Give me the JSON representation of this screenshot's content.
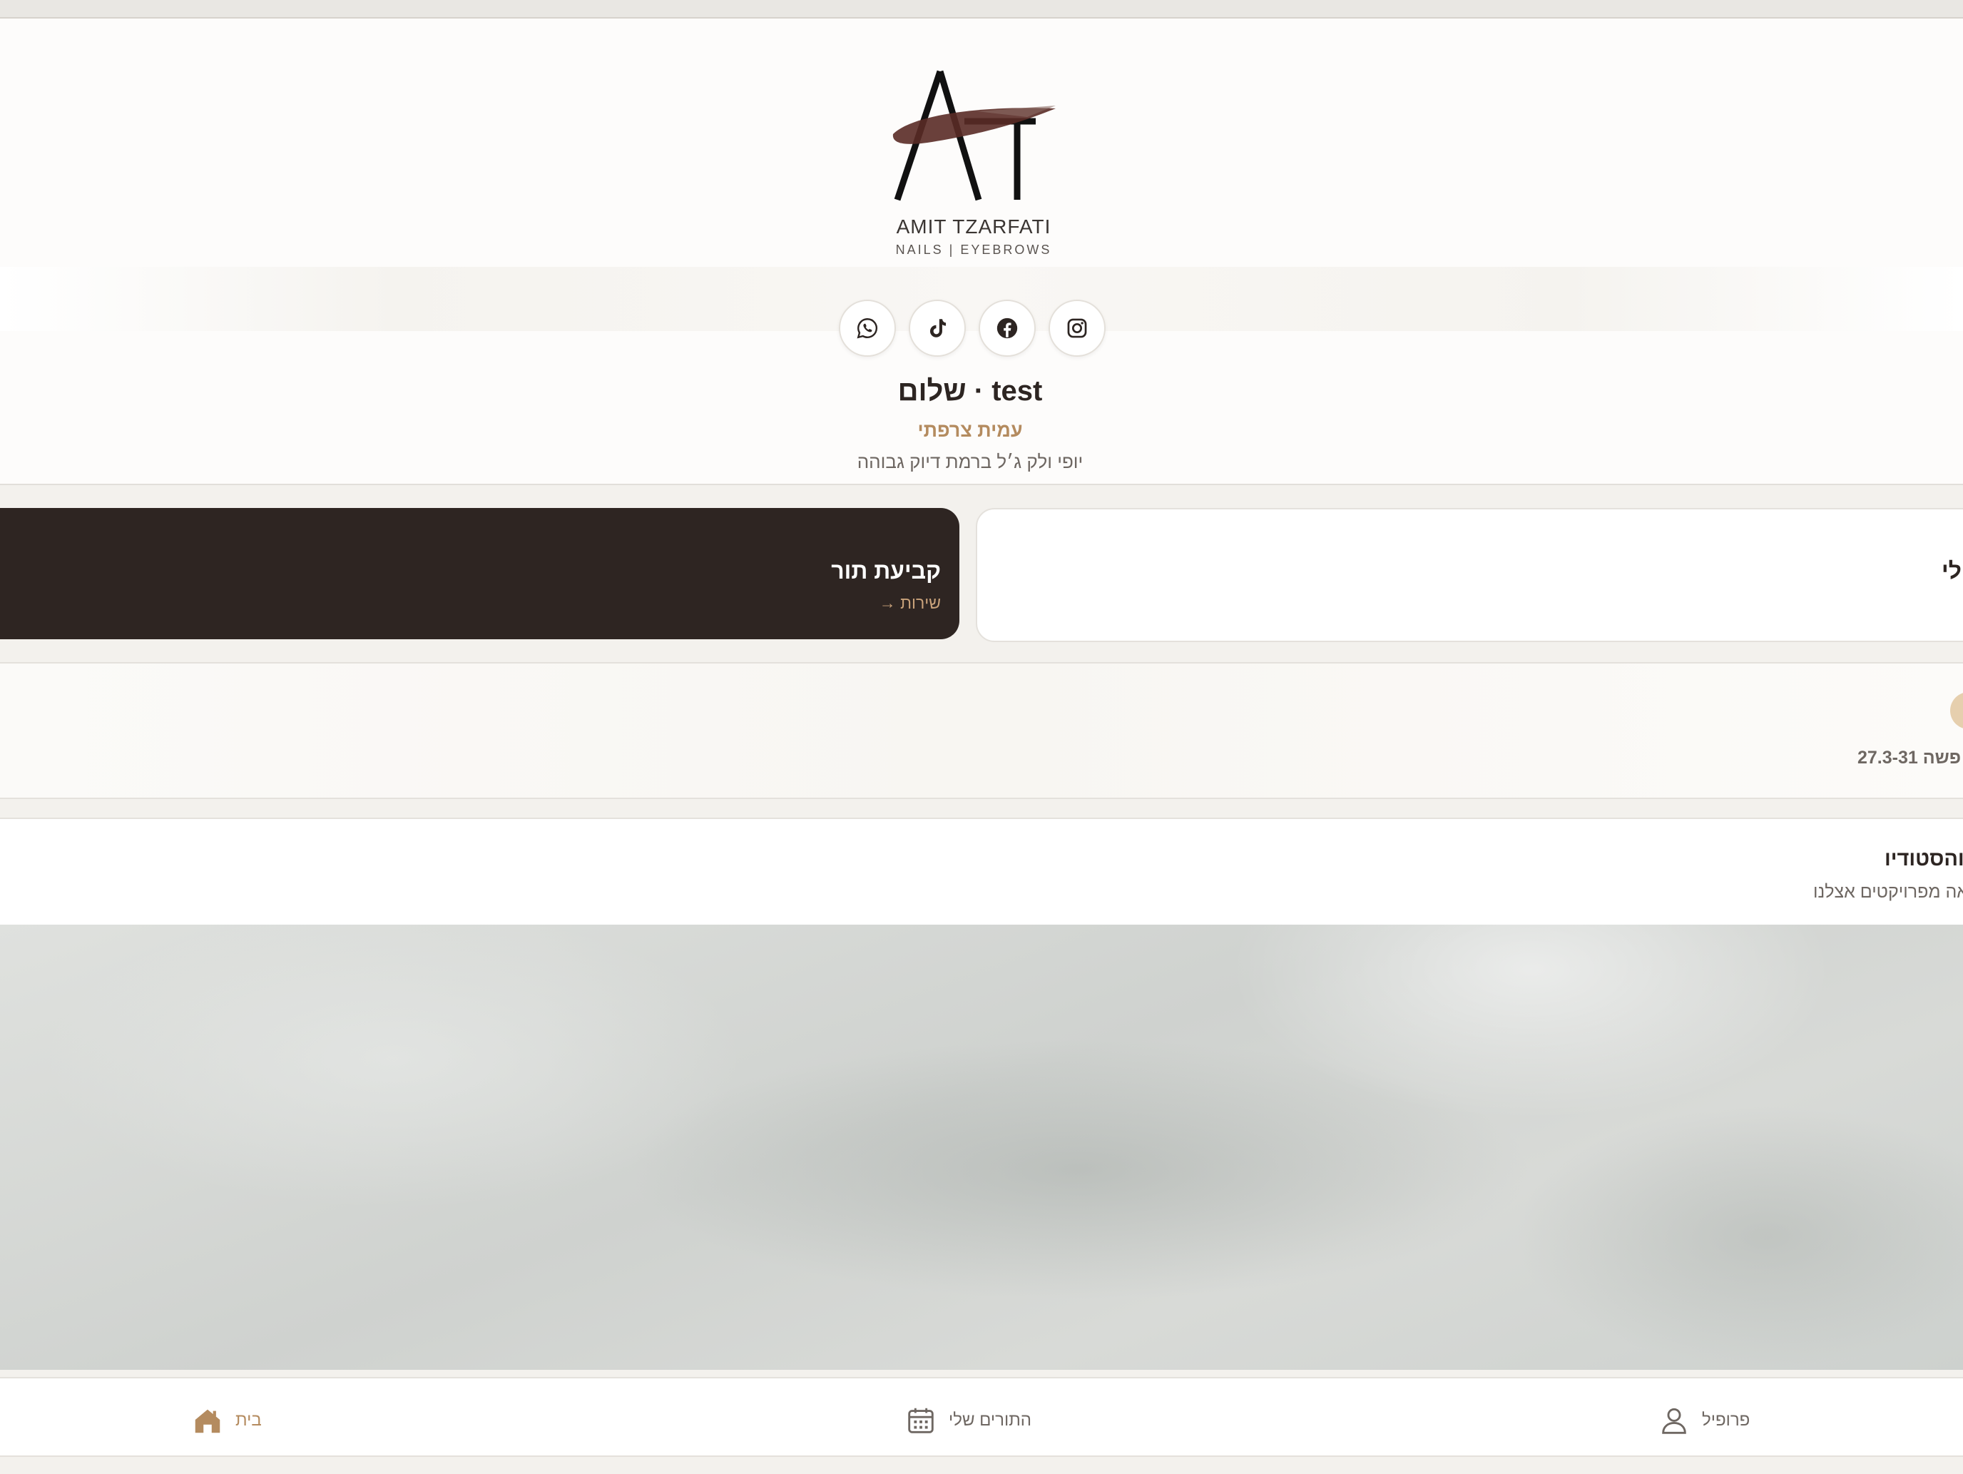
{
  "logo": {
    "mark": "AT",
    "name": "AMIT TZARFATI",
    "sub": "NAILS | EYEBROWS"
  },
  "socials": [
    "whatsapp-icon",
    "tiktok-icon",
    "facebook-icon",
    "instagram-icon"
  ],
  "greeting": "test · שלום",
  "owner": "עמית צרפתי",
  "tagline": "יופי ולק ג׳ל ברמת דיוק גבוהה",
  "cards": {
    "book": {
      "title": "קביעת תור",
      "sub": "שירות →"
    },
    "mine": {
      "title": "לי"
    }
  },
  "promo": {
    "text": "פשה 27.3-31"
  },
  "studio": {
    "title": "והסטודיו",
    "sub": "אה מפרויקטים אצלנו"
  },
  "nav": {
    "home": "בית",
    "appointments": "התורים שלי",
    "profile": "פרופיל"
  },
  "colors": {
    "accent": "#b48b5f",
    "dark": "#2e2522",
    "background": "#f3f1ed"
  }
}
